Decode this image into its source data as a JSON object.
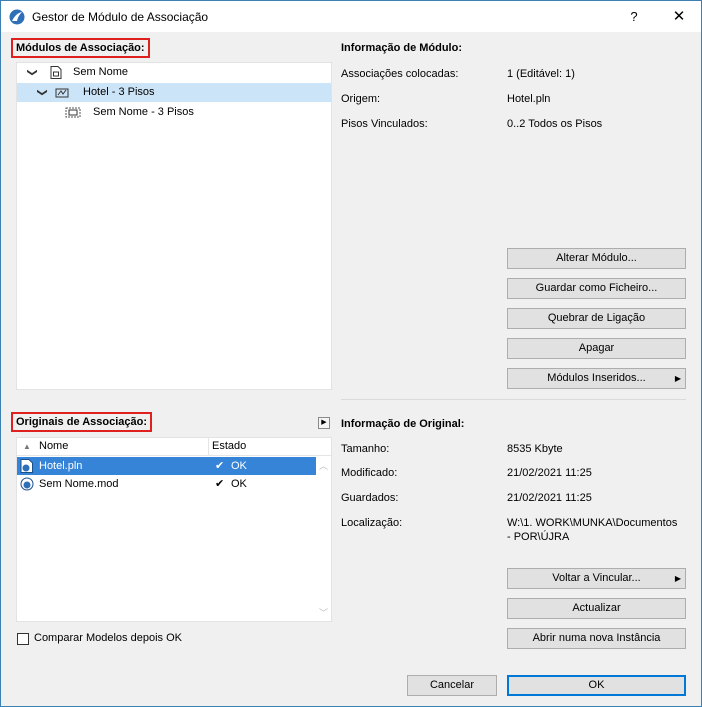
{
  "window": {
    "title": "Gestor de Módulo de Associação",
    "help_label": "?",
    "close_label": "✕"
  },
  "modules": {
    "section_label": "Módulos de Associação:",
    "tree": [
      {
        "label": "Sem Nome",
        "chevron": "❯"
      },
      {
        "label": "Hotel - 3 Pisos",
        "chevron": "❯"
      },
      {
        "label": "Sem Nome - 3 Pisos",
        "chevron": ""
      }
    ]
  },
  "module_info": {
    "header": "Informação de Módulo:",
    "rows": [
      {
        "label": "Associações colocadas:",
        "value": "1 (Editável: 1)"
      },
      {
        "label": "Origem:",
        "value": "Hotel.pln"
      },
      {
        "label": "Pisos Vinculados:",
        "value": "0..2 Todos os Pisos"
      }
    ],
    "buttons": {
      "change": "Alterar Módulo...",
      "save_as_file": "Guardar como Ficheiro...",
      "break_link": "Quebrar de Ligação",
      "delete": "Apagar",
      "inserted_modules": "Módulos Inseridos..."
    }
  },
  "originals": {
    "section_label": "Originais de Associação:",
    "col_name": "Nome",
    "col_status": "Estado",
    "rows": [
      {
        "name": "Hotel.pln",
        "status": "OK",
        "check": "✔"
      },
      {
        "name": "Sem Nome.mod",
        "status": "OK",
        "check": "✔"
      }
    ],
    "compare_label": "Comparar Modelos depois OK",
    "expand_glyph": "▶"
  },
  "original_info": {
    "header": "Informação de Original:",
    "rows": [
      {
        "label": "Tamanho:",
        "value": "8535 Kbyte"
      },
      {
        "label": "Modificado:",
        "value": "21/02/2021 11:25"
      },
      {
        "label": "Guardados:",
        "value": "21/02/2021 11:25"
      },
      {
        "label": "Localização:",
        "value": "W:\\1. WORK\\MUNKA\\Documentos",
        "value2": "- POR\\ÚJRA"
      }
    ],
    "buttons": {
      "relink": "Voltar a Vincular...",
      "update": "Actualizar",
      "open_new_instance": "Abrir numa nova Instância"
    }
  },
  "footer": {
    "cancel": "Cancelar",
    "ok": "OK"
  },
  "colors": {
    "highlight_red": "#e01f1f",
    "selection_blue": "#3584d8",
    "tree_selection": "#cce4f7",
    "primary_border": "#0078d7"
  }
}
